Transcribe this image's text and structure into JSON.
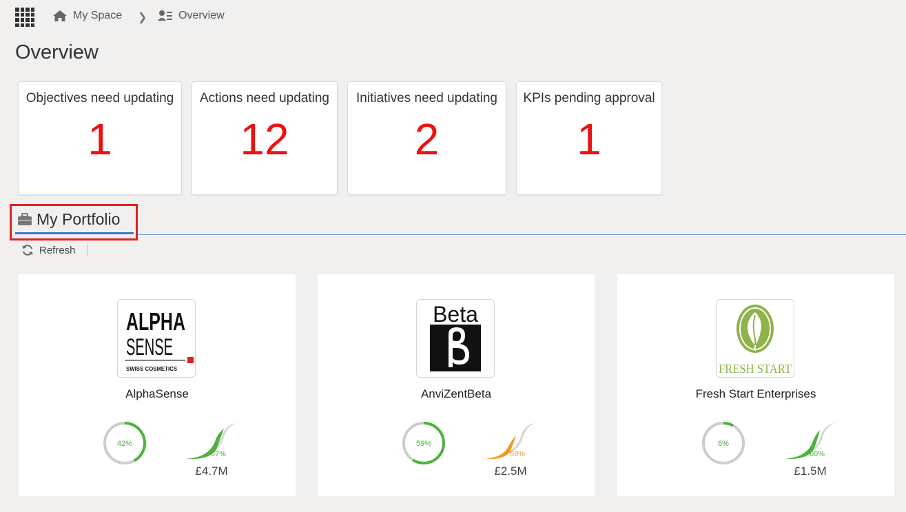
{
  "breadcrumb": {
    "home_label": "My Space",
    "current_label": "Overview"
  },
  "page_title": "Overview",
  "summary_cards": [
    {
      "label": "Objectives need updating",
      "count": "1"
    },
    {
      "label": "Actions need updating",
      "count": "12"
    },
    {
      "label": "Initiatives need updating",
      "count": "2"
    },
    {
      "label": "KPIs pending approval",
      "count": "1"
    }
  ],
  "portfolio": {
    "tab_label": "My Portfolio",
    "refresh_label": "Refresh",
    "items": [
      {
        "name": "AlphaSense",
        "logo_text": [
          "ALPHA",
          "SENSE",
          "SWISS COSMETICS"
        ],
        "progress_label": "42%",
        "progress": 0.42,
        "gauge_label": "67%",
        "gauge_color": "#4db33d",
        "budget": "£4.7M"
      },
      {
        "name": "AnviZentBeta",
        "logo_text": [
          "Beta"
        ],
        "progress_label": "59%",
        "progress": 0.59,
        "gauge_label": "59%",
        "gauge_color": "#f09a1e",
        "budget": "£2.5M"
      },
      {
        "name": "Fresh Start Enterprises",
        "logo_text": [
          "FRESH START"
        ],
        "progress_label": "8%",
        "progress": 0.08,
        "gauge_label": "60%",
        "gauge_color": "#4db33d",
        "budget": "£1.5M"
      }
    ]
  },
  "colors": {
    "count_red": "#ee1111",
    "progress_green": "#4db33d",
    "track_gray": "#cccccc",
    "tab_underline": "#3a78c8",
    "highlight_red": "#e02020"
  }
}
